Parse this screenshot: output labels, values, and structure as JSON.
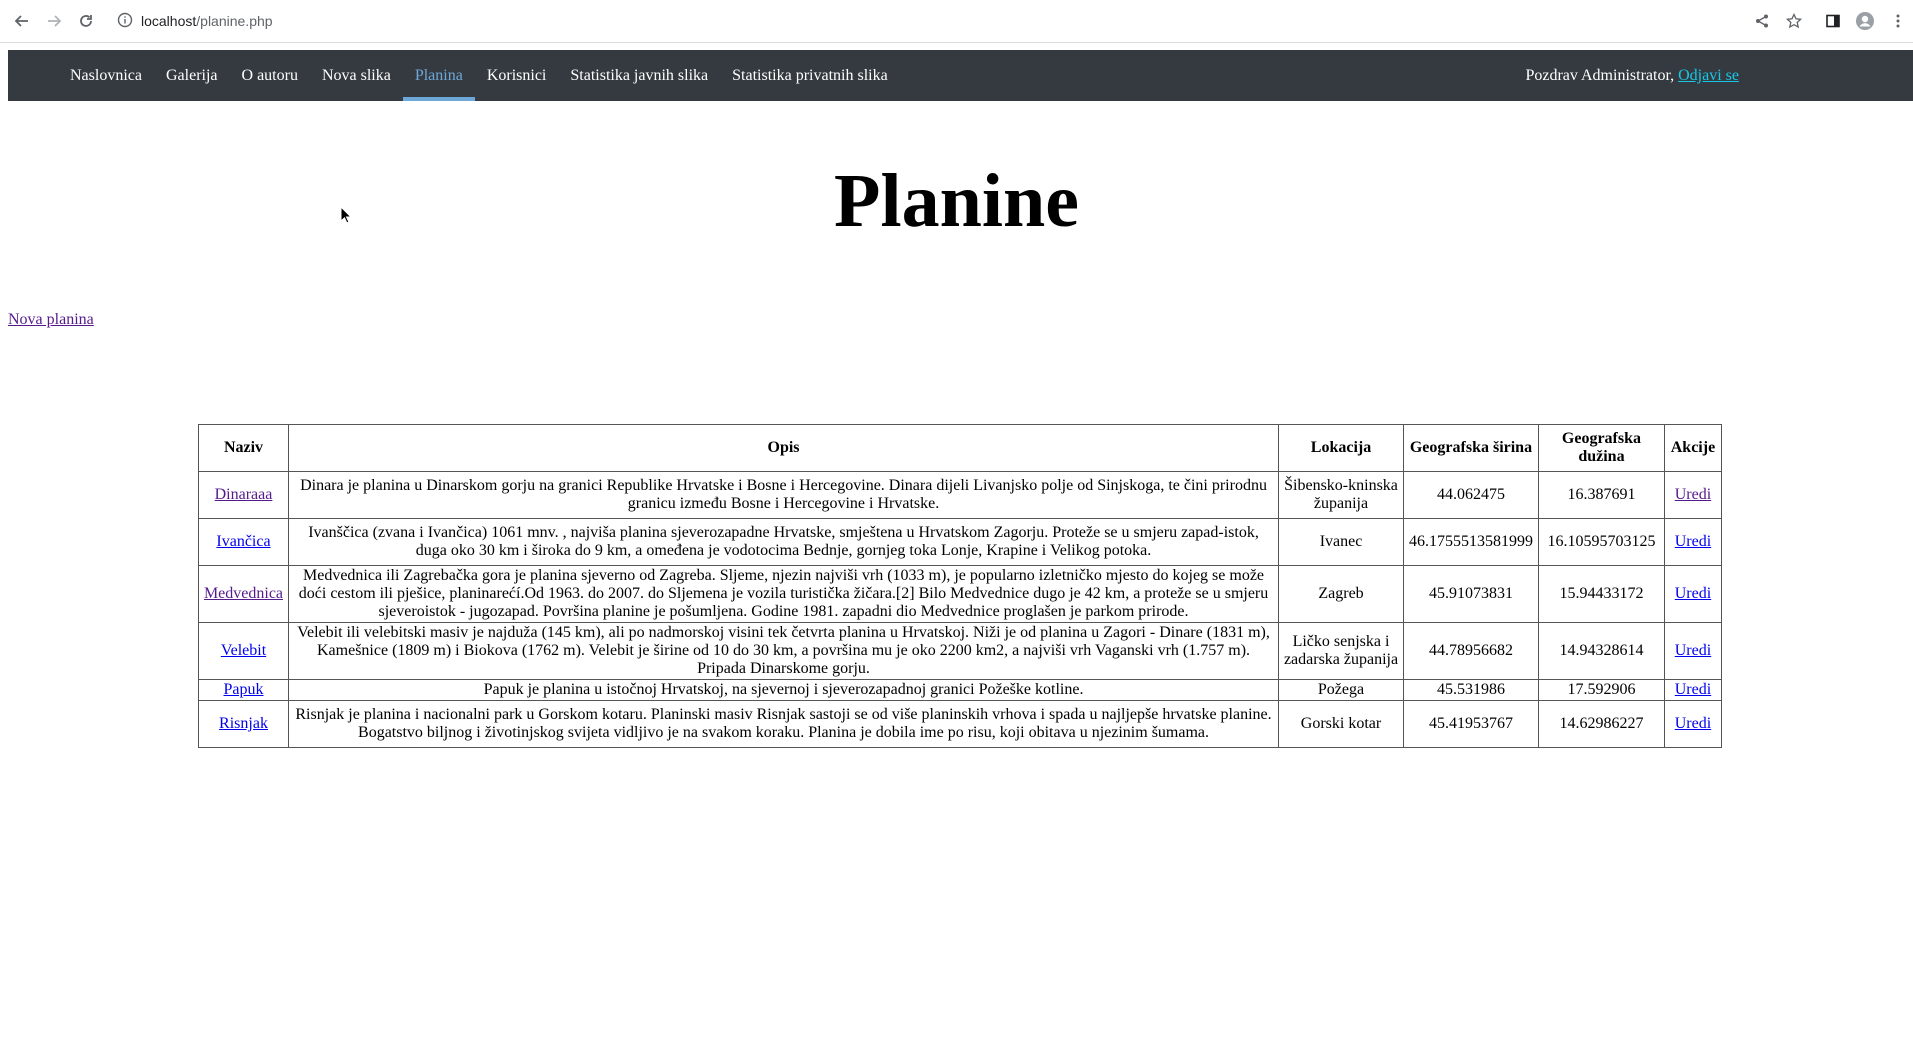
{
  "browser": {
    "url_host": "localhost",
    "url_path": "/planine.php"
  },
  "navbar": {
    "items": [
      {
        "label": "Naslovnica",
        "active": false
      },
      {
        "label": "Galerija",
        "active": false
      },
      {
        "label": "O autoru",
        "active": false
      },
      {
        "label": "Nova slika",
        "active": false
      },
      {
        "label": "Planina",
        "active": true
      },
      {
        "label": "Korisnici",
        "active": false
      },
      {
        "label": "Statistika javnih slika",
        "active": false
      },
      {
        "label": "Statistika privatnih slika",
        "active": false
      }
    ],
    "greeting": "Pozdrav Administrator, ",
    "logout_label": "Odjavi se"
  },
  "page": {
    "title": "Planine",
    "new_link": "Nova planina"
  },
  "table": {
    "headers": {
      "naziv": "Naziv",
      "opis": "Opis",
      "lokacija": "Lokacija",
      "sirina": "Geografska širina",
      "duzina": "Geografska dužina",
      "akcije": "Akcije"
    },
    "rows": [
      {
        "naziv": "Dinaraaa",
        "opis": "Dinara je planina u Dinarskom gorju na granici Republike Hrvatske i Bosne i Hercegovine. Dinara dijeli Livanjsko polje od Sinjskoga, te čini prirodnu granicu između Bosne i Hercegovine i Hrvatske.",
        "lokacija": "Šibensko-kninska županija",
        "sirina": "44.062475",
        "duzina": "16.387691",
        "akcija": "Uredi"
      },
      {
        "naziv": "Ivančica",
        "opis": "Ivanščica (zvana i Ivančica) 1061 mnv. , najviša planina sjeverozapadne Hrvatske, smještena u Hrvatskom Zagorju. Proteže se u smjeru zapad-istok, duga oko 30 km i široka do 9 km, a omeđena je vodotocima Bednje, gornjeg toka Lonje, Krapine i Velikog potoka.",
        "lokacija": "Ivanec",
        "sirina": "46.1755513581999",
        "duzina": "16.10595703125",
        "akcija": "Uredi"
      },
      {
        "naziv": "Medvednica",
        "opis": "Medvednica ili Zagrebačka gora je planina sjeverno od Zagreba. Sljeme, njezin najviši vrh (1033 m), je popularno izletničko mjesto do kojeg se može doći cestom ili pješice, planinarećí.Od 1963. do 2007. do Sljemena je vozila turistička žičara.[2] Bilo Medvednice dugo je 42 km, a proteže se u smjeru sjeveroistok - jugozapad. Površina planine je pošumljena. Godine 1981. zapadni dio Medvednice proglašen je parkom prirode.",
        "lokacija": "Zagreb",
        "sirina": "45.91073831",
        "duzina": "15.94433172",
        "akcija": "Uredi"
      },
      {
        "naziv": "Velebit",
        "opis": "Velebit ili velebitski masiv je najduža (145 km), ali po nadmorskoj visini tek četvrta planina u Hrvatskoj. Niži je od planina u Zagori - Dinare (1831 m), Kamešnice (1809 m) i Biokova (1762 m). Velebit je širine od 10 do 30 km, a površina mu je oko 2200 km2, a najviši vrh Vaganski vrh (1.757 m). Pripada Dinarskome gorju.",
        "lokacija": "Ličko senjska i zadarska županija",
        "sirina": "44.78956682",
        "duzina": "14.94328614",
        "akcija": "Uredi"
      },
      {
        "naziv": "Papuk",
        "opis": "Papuk je planina u istočnoj Hrvatskoj, na sjevernoj i sjeverozapadnoj granici Požeške kotline.",
        "lokacija": "Požega",
        "sirina": "45.531986",
        "duzina": "17.592906",
        "akcija": "Uredi"
      },
      {
        "naziv": "Risnjak",
        "opis": "Risnjak je planina i nacionalni park u Gorskom kotaru. Planinski masiv Risnjak sastoji se od više planinskih vrhova i spada u najljepše hrvatske planine. Bogatstvo biljnog i životinjskog svijeta vidljivo je na svakom koraku. Planina je dobila ime po risu, koji obitava u njezinim šumama.",
        "lokacija": "Gorski kotar",
        "sirina": "45.41953767",
        "duzina": "14.62986227",
        "akcija": "Uredi"
      }
    ]
  }
}
